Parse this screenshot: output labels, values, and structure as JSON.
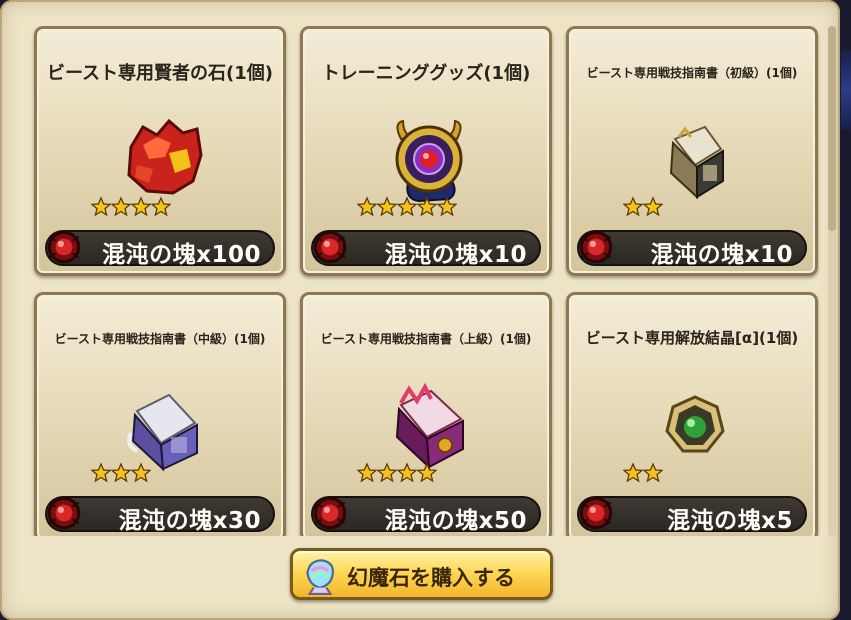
{
  "cards": [
    {
      "title": "ビースト専用賢者の石(1個)",
      "cost": "混沌の塊x100",
      "stars": 4,
      "item_icon": "sage-stone-icon"
    },
    {
      "title": "トレーニンググッズ(1個)",
      "cost": "混沌の塊x10",
      "stars": 5,
      "item_icon": "training-goods-icon"
    },
    {
      "title": "ビースト専用戦技指南書（初級）(1個)",
      "cost": "混沌の塊x10",
      "stars": 2,
      "item_icon": "beginner-manual-icon"
    },
    {
      "title": "ビースト専用戦技指南書（中級）(1個)",
      "cost": "混沌の塊x30",
      "stars": 3,
      "item_icon": "intermediate-manual-icon"
    },
    {
      "title": "ビースト専用戦技指南書（上級）(1個)",
      "cost": "混沌の塊x50",
      "stars": 4,
      "item_icon": "advanced-manual-icon"
    },
    {
      "title": "ビースト専用解放結晶[α](1個)",
      "cost": "混沌の塊x5",
      "stars": 2,
      "item_icon": "release-crystal-icon"
    }
  ],
  "buy_button": {
    "label": "幻魔石を購入する",
    "icon": "phantom-stone-icon"
  },
  "colors": {
    "panel": "#ede3c6",
    "card_border": "#8c7851",
    "cost_bar": "#2f2a24",
    "button": "#ffd85a",
    "star": "#f7c21a"
  }
}
